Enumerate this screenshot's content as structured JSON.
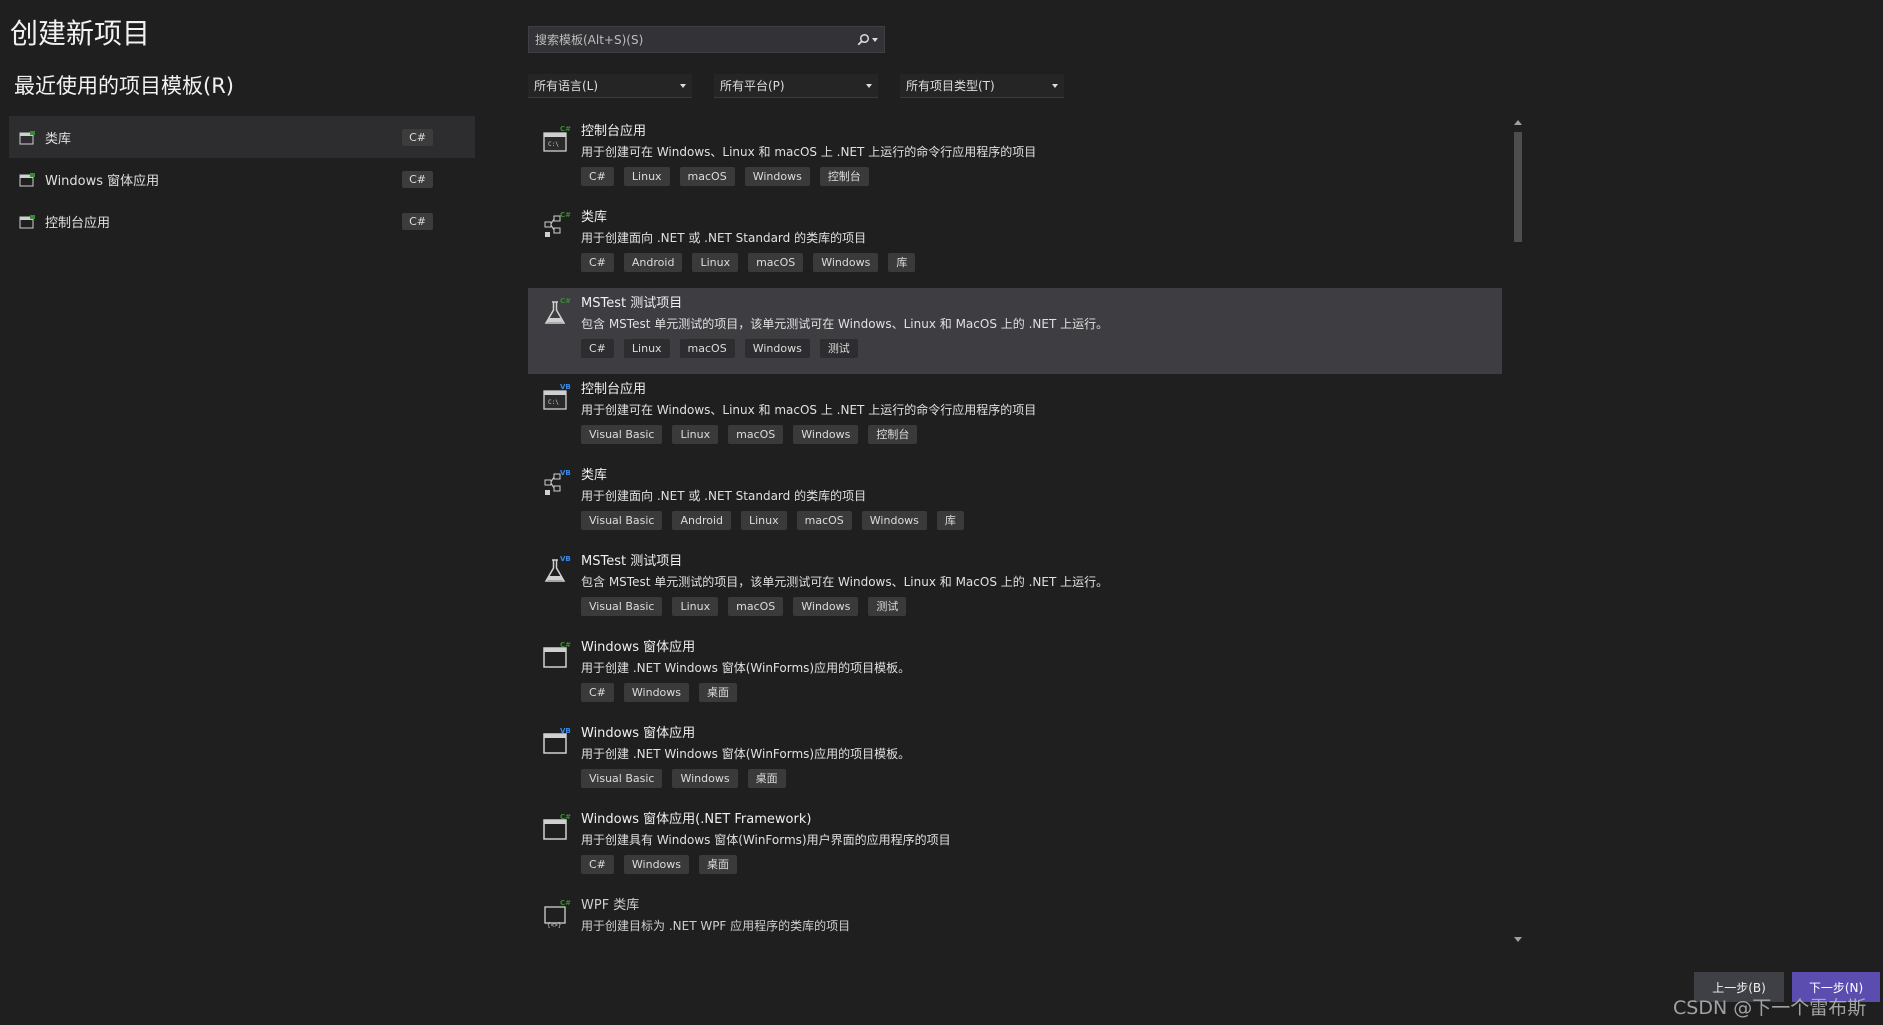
{
  "page": {
    "title": "创建新项目",
    "recent_heading": "最近使用的项目模板(R)"
  },
  "recent": [
    {
      "label": "类库",
      "lang": "C#",
      "icon": "class-library-icon"
    },
    {
      "label": "Windows 窗体应用",
      "lang": "C#",
      "icon": "windows-form-icon"
    },
    {
      "label": "控制台应用",
      "lang": "C#",
      "icon": "console-app-icon"
    }
  ],
  "search": {
    "placeholder": "搜索模板(Alt+S)(S)"
  },
  "filters": {
    "language": "所有语言(L)",
    "platform": "所有平台(P)",
    "project_type": "所有项目类型(T)"
  },
  "templates": [
    {
      "name": "控制台应用",
      "desc": "用于创建可在 Windows、Linux 和 macOS 上 .NET 上运行的命令行应用程序的项目",
      "tags": [
        "C#",
        "Linux",
        "macOS",
        "Windows",
        "控制台"
      ],
      "badge": "C#",
      "icon": "console-app-icon"
    },
    {
      "name": "类库",
      "desc": "用于创建面向 .NET 或 .NET Standard 的类库的项目",
      "tags": [
        "C#",
        "Android",
        "Linux",
        "macOS",
        "Windows",
        "库"
      ],
      "badge": "C#",
      "icon": "class-library-icon"
    },
    {
      "name": "MSTest 测试项目",
      "desc": "包含 MSTest 单元测试的项目，该单元测试可在 Windows、Linux 和 MacOS 上的 .NET 上运行。",
      "tags": [
        "C#",
        "Linux",
        "macOS",
        "Windows",
        "测试"
      ],
      "badge": "C#",
      "icon": "test-flask-icon"
    },
    {
      "name": "控制台应用",
      "desc": "用于创建可在 Windows、Linux 和 macOS 上 .NET 上运行的命令行应用程序的项目",
      "tags": [
        "Visual Basic",
        "Linux",
        "macOS",
        "Windows",
        "控制台"
      ],
      "badge": "VB",
      "icon": "console-app-icon"
    },
    {
      "name": "类库",
      "desc": "用于创建面向 .NET 或 .NET Standard 的类库的项目",
      "tags": [
        "Visual Basic",
        "Android",
        "Linux",
        "macOS",
        "Windows",
        "库"
      ],
      "badge": "VB",
      "icon": "class-library-icon"
    },
    {
      "name": "MSTest 测试项目",
      "desc": "包含 MSTest 单元测试的项目，该单元测试可在 Windows、Linux 和 MacOS 上的 .NET 上运行。",
      "tags": [
        "Visual Basic",
        "Linux",
        "macOS",
        "Windows",
        "测试"
      ],
      "badge": "VB",
      "icon": "test-flask-icon"
    },
    {
      "name": "Windows 窗体应用",
      "desc": "用于创建 .NET Windows 窗体(WinForms)应用的项目模板。",
      "tags": [
        "C#",
        "Windows",
        "桌面"
      ],
      "badge": "C#",
      "icon": "windows-form-icon"
    },
    {
      "name": "Windows 窗体应用",
      "desc": "用于创建 .NET Windows 窗体(WinForms)应用的项目模板。",
      "tags": [
        "Visual Basic",
        "Windows",
        "桌面"
      ],
      "badge": "VB",
      "icon": "windows-form-icon"
    },
    {
      "name": "Windows 窗体应用(.NET Framework)",
      "desc": "用于创建具有 Windows 窗体(WinForms)用户界面的应用程序的项目",
      "tags": [
        "C#",
        "Windows",
        "桌面"
      ],
      "badge": "C#",
      "icon": "windows-form-icon"
    },
    {
      "name": "WPF 类库",
      "desc": "用于创建目标为 .NET WPF 应用程序的类库的项目",
      "tags": [],
      "badge": "C#",
      "icon": "wpf-library-icon"
    }
  ],
  "selected_template_index": 2,
  "buttons": {
    "back": "上一步(B)",
    "next": "下一步(N)"
  },
  "watermark": "CSDN @下一个雷布斯",
  "colors": {
    "background": "#1f1f1f",
    "selected": "#3e3e42",
    "next_button": "#5b4db0",
    "badge_cs": "#388a34",
    "badge_vb": "#3c8be8"
  }
}
